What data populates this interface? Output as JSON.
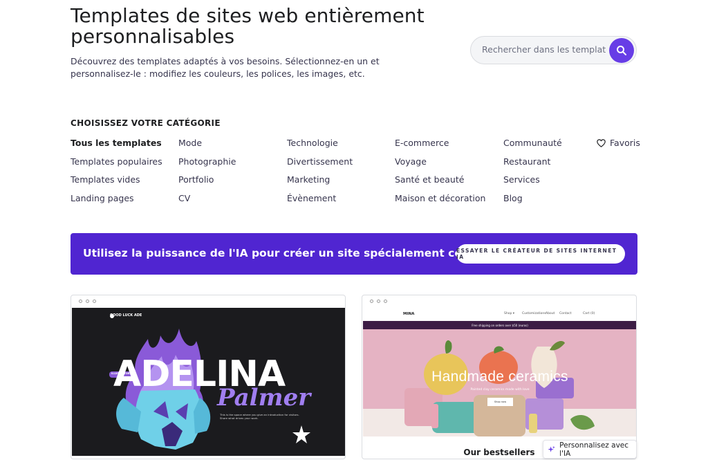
{
  "header": {
    "title": "Templates de sites web entièrement personnalisables",
    "description": "Découvrez des templates adaptés à vos besoins. Sélectionnez-en un et personnalisez-le : modifiez les couleurs, les polices, les images, etc."
  },
  "search": {
    "placeholder": "Rechercher dans les template",
    "button_icon": "search-icon"
  },
  "categories": {
    "title": "CHOISISSEZ VOTRE CATÉGORIE",
    "columns": [
      [
        "Tous les templates",
        "Templates populaires",
        "Templates vides",
        "Landing pages"
      ],
      [
        "Mode",
        "Photographie",
        "Portfolio",
        "CV"
      ],
      [
        "Technologie",
        "Divertissement",
        "Marketing",
        "Évènement"
      ],
      [
        "E-commerce",
        "Voyage",
        "Santé et beauté",
        "Maison et décoration"
      ],
      [
        "Communauté",
        "Restaurant",
        "Services",
        "Blog"
      ]
    ],
    "active": "Tous les templates",
    "favorites_label": "Favoris",
    "favorites_icon": "heart-icon"
  },
  "ai_banner": {
    "text": "Utilisez la puissance de l'IA pour créer un site spécialement conçu pour vous",
    "button_label": "ESSAYER LE CRÉATEUR DE SITES INTERNET IA",
    "background": "#5025d1"
  },
  "template_cards": [
    {
      "logo": "GOOD LUCK ADE",
      "headline": "ADELINA",
      "subheadline": "Palmer",
      "badge": "ILLUSTRATOR",
      "body": "This is the space where you give an introduction for visitors. Share what drives your work."
    },
    {
      "brand": "MINA",
      "nav": [
        "Shop ▾",
        "Customizations",
        "About",
        "Contact",
        "Cart (0)"
      ],
      "promo": "Free shipping on orders over $50 (euros)",
      "headline": "Handmade ceramics",
      "subheadline": "Painted clay ceramics made with love",
      "button": "Shop now",
      "section_title": "Our bestsellers"
    }
  ],
  "ai_chip": {
    "label": "Personnalisez avec l'IA",
    "icon": "sparkle-icon"
  },
  "colors": {
    "accent": "#673de6",
    "text": "#1d1e20"
  }
}
